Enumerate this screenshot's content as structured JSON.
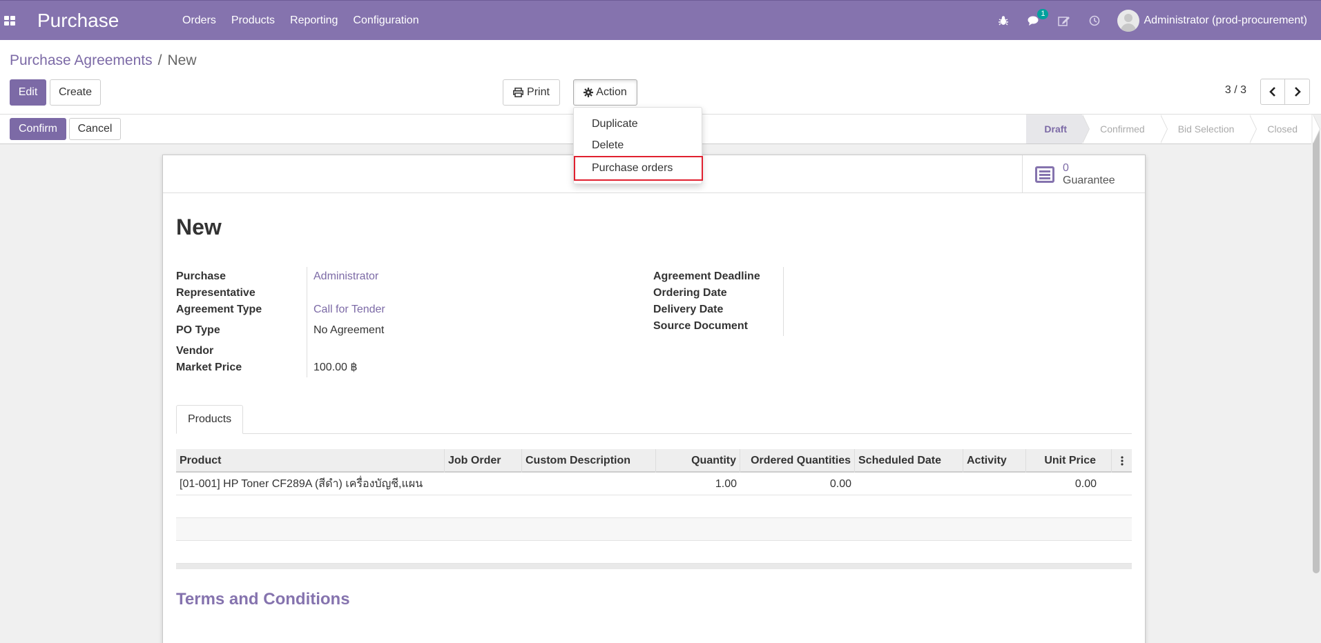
{
  "navbar": {
    "app_name": "Purchase",
    "menu": [
      "Orders",
      "Products",
      "Reporting",
      "Configuration"
    ],
    "chat_badge": "1",
    "user_name": "Administrator (prod-procurement)"
  },
  "breadcrumb": {
    "parent": "Purchase Agreements",
    "separator": "/",
    "current": "New"
  },
  "control": {
    "edit_label": "Edit",
    "create_label": "Create",
    "print_label": "Print",
    "action_label": "Action",
    "pager": "3 / 3"
  },
  "action_menu": {
    "items": [
      "Duplicate",
      "Delete",
      "Purchase orders"
    ],
    "highlighted": "Purchase orders"
  },
  "statusbar": {
    "confirm_label": "Confirm",
    "cancel_label": "Cancel",
    "stages": [
      "Draft",
      "Confirmed",
      "Bid Selection",
      "Closed"
    ],
    "active_stage": "Draft"
  },
  "smart_button": {
    "value": "0",
    "label": "Guarantee"
  },
  "record": {
    "title": "New",
    "left_fields": {
      "purchase_rep_label_1": "Purchase",
      "purchase_rep_label_2": "Representative",
      "purchase_rep_value": "Administrator",
      "agreement_type_label": "Agreement Type",
      "agreement_type_value": "Call for Tender",
      "po_type_label": "PO Type",
      "po_type_value": "No Agreement",
      "vendor_label": "Vendor",
      "vendor_value": "",
      "market_price_label": "Market Price",
      "market_price_value": "100.00 ฿"
    },
    "right_fields": {
      "agreement_deadline_label": "Agreement Deadline",
      "ordering_date_label": "Ordering Date",
      "delivery_date_label": "Delivery Date",
      "source_document_label": "Source Document"
    }
  },
  "tabs": {
    "products": "Products"
  },
  "products_table": {
    "columns": [
      "Product",
      "Job Order",
      "Custom Description",
      "Quantity",
      "Ordered Quantities",
      "Scheduled Date",
      "Activity",
      "Unit Price"
    ],
    "rows": [
      {
        "product": "[01-001] HP Toner CF289A (สีดำ) เครื่องบัญชี,แผน",
        "job_order": "",
        "custom_description": "",
        "quantity": "1.00",
        "ordered_quantities": "0.00",
        "scheduled_date": "",
        "activity": "",
        "unit_price": "0.00"
      }
    ]
  },
  "terms": {
    "title": "Terms and Conditions"
  },
  "colors": {
    "brand": "#8573ae",
    "link": "#7c6aa6",
    "highlight_border": "#e0202f",
    "badge": "#00a09d"
  }
}
